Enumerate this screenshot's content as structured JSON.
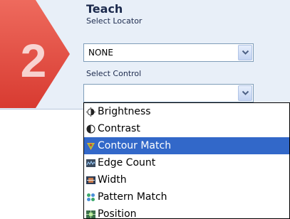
{
  "step": {
    "number": "2"
  },
  "panel": {
    "title": "Teach",
    "locator_label": "Select Locator",
    "locator_value": "NONE",
    "control_label": "Select Control",
    "control_value": ""
  },
  "dropdown": {
    "selected_index": 2,
    "options": [
      {
        "label": "Brightness",
        "icon": "brightness-icon"
      },
      {
        "label": "Contrast",
        "icon": "contrast-icon"
      },
      {
        "label": "Contour Match",
        "icon": "contour-match-icon"
      },
      {
        "label": "Edge Count",
        "icon": "edge-count-icon"
      },
      {
        "label": "Width",
        "icon": "width-icon"
      },
      {
        "label": "Pattern Match",
        "icon": "pattern-match-icon"
      },
      {
        "label": "Position",
        "icon": "position-icon"
      }
    ]
  },
  "colors": {
    "badge": "#e3493d",
    "selection": "#3268c9",
    "panel": "#e8eff8"
  }
}
